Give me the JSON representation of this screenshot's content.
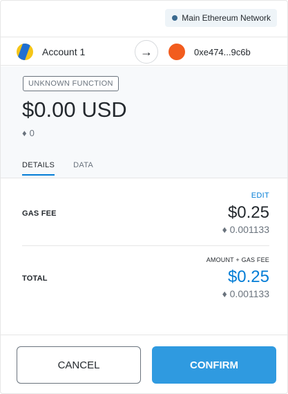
{
  "network": {
    "label": "Main Ethereum Network",
    "dot_color": "#3b6a8f",
    "icon": "network-dot-icon"
  },
  "sender": {
    "name": "Account 1",
    "icon": "identicon-icon"
  },
  "recipient": {
    "address": "0xe474...9c6b",
    "icon": "identicon-icon"
  },
  "arrow_icon": "→",
  "summary": {
    "function_label": "UNKNOWN FUNCTION",
    "fiat_amount": "$0.00 USD",
    "eth_symbol": "♦",
    "eth_amount": "0"
  },
  "tabs": [
    {
      "label": "DETAILS",
      "active": true
    },
    {
      "label": "DATA",
      "active": false
    }
  ],
  "details": {
    "edit_label": "EDIT",
    "gas_fee_label": "GAS FEE",
    "gas_fee_fiat": "$0.25",
    "gas_fee_eth": "♦ 0.001133",
    "total_heading": "AMOUNT + GAS FEE",
    "total_label": "TOTAL",
    "total_fiat": "$0.25",
    "total_eth": "♦ 0.001133"
  },
  "buttons": {
    "cancel": "CANCEL",
    "confirm": "CONFIRM"
  },
  "colors": {
    "accent": "#037dd6",
    "confirm_bg": "#2f9ae0"
  }
}
